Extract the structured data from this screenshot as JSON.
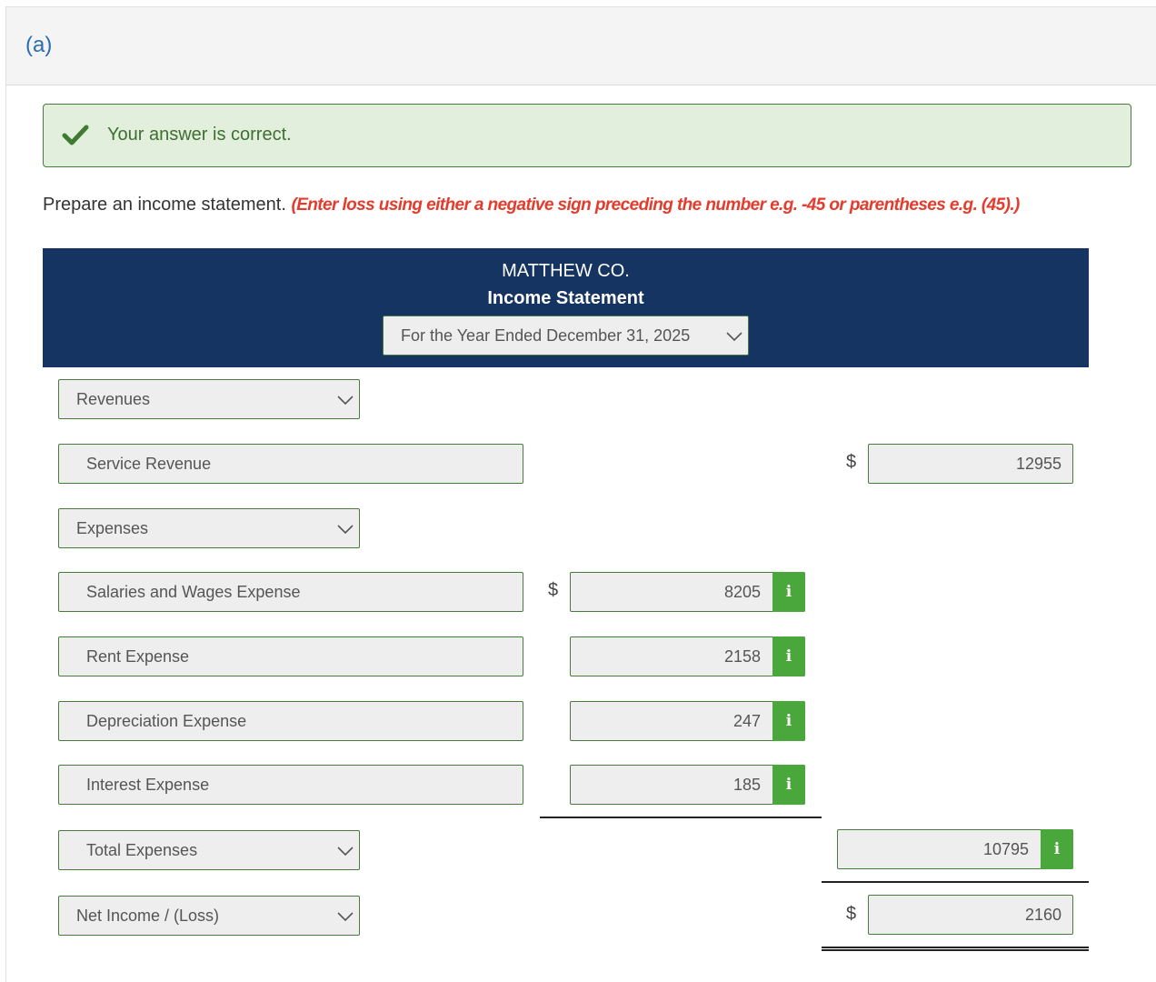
{
  "part": {
    "label": "(a)"
  },
  "feedback": {
    "icon": "check-icon",
    "message": "Your answer is correct.",
    "color": "#3f6e33"
  },
  "instructions": {
    "text": "Prepare an income statement.",
    "note": "(Enter loss using either a negative sign preceding the number e.g. -45 or parentheses e.g. (45).)",
    "note_color": "#e53b2c"
  },
  "statement": {
    "company": "MATTHEW CO.",
    "title": "Income Statement",
    "period": "For the Year Ended December 31, 2025",
    "header_color": "#153462"
  },
  "rows": {
    "revenues_heading": "Revenues",
    "service_revenue": {
      "label": "Service Revenue",
      "currency": "$",
      "amount": "12955"
    },
    "expenses_heading": "Expenses",
    "salaries": {
      "label": "Salaries and Wages Expense",
      "currency": "$",
      "amount": "8205",
      "info": "i"
    },
    "rent": {
      "label": "Rent Expense",
      "amount": "2158",
      "info": "i"
    },
    "depreciation": {
      "label": "Depreciation Expense",
      "amount": "247",
      "info": "i"
    },
    "interest": {
      "label": "Interest Expense",
      "amount": "185",
      "info": "i"
    },
    "total_expenses": {
      "label": "Total Expenses",
      "amount": "10795",
      "info": "i"
    },
    "net_income": {
      "label": "Net Income / (Loss)",
      "currency": "$",
      "amount": "2160"
    }
  },
  "accent": {
    "info_button": "#4aa73b",
    "field_border": "#4a7a3f"
  }
}
